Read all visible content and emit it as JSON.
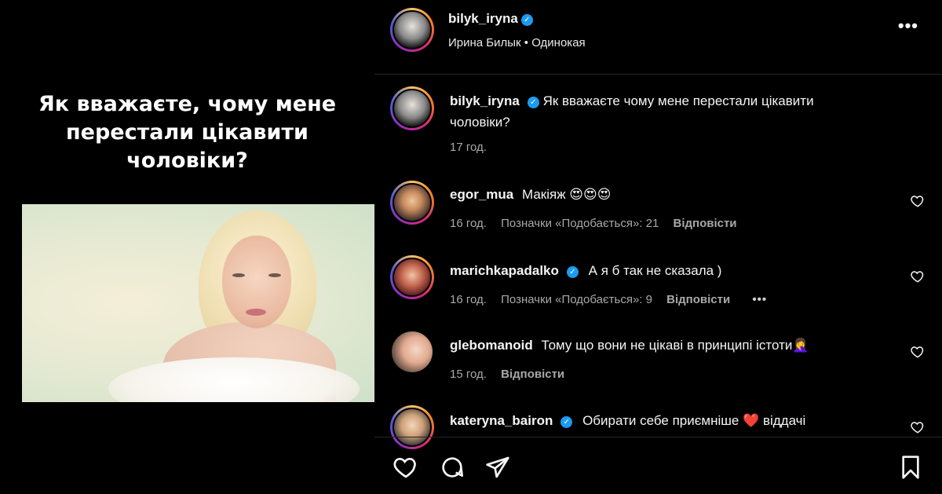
{
  "media": {
    "caption": "Як вважаєте, чому мене перестали цікавити чоловіки?"
  },
  "header": {
    "username": "bilyk_iryna",
    "verified": true,
    "subtitle": "Ирина Билык • Одинокая",
    "more_label": "•••"
  },
  "post": {
    "username": "bilyk_iryna",
    "text": "Як вважаєте чому мене перестали цікавити чоловіки?",
    "time": "17 год."
  },
  "comments": [
    {
      "username": "egor_mua",
      "verified": false,
      "text": "Макіяж 😍😍😍",
      "time": "16 год.",
      "likes": "Позначки «Подобається»: 21",
      "reply": "Відповісти"
    },
    {
      "username": "marichkapadalko",
      "verified": true,
      "text": "А я б так не сказала )",
      "time": "16 год.",
      "likes": "Позначки «Подобається»: 9",
      "reply": "Відповісти",
      "more": "•••"
    },
    {
      "username": "glebomanoid",
      "verified": false,
      "text": "Тому що вони не цікаві в принципі істоти🤦‍♀️",
      "time": "15 год.",
      "reply": "Відповісти"
    },
    {
      "username": "kateryna_bairon",
      "verified": true,
      "text": "Обирати себе приємніше ❤️ віддачі"
    }
  ],
  "icons": {
    "like": "heart-icon",
    "comment": "comment-icon",
    "share": "send-icon",
    "save": "bookmark-icon"
  },
  "colors": {
    "background": "#000000",
    "verified": "#1d9bf0",
    "meta_text": "#a8a8a8"
  }
}
